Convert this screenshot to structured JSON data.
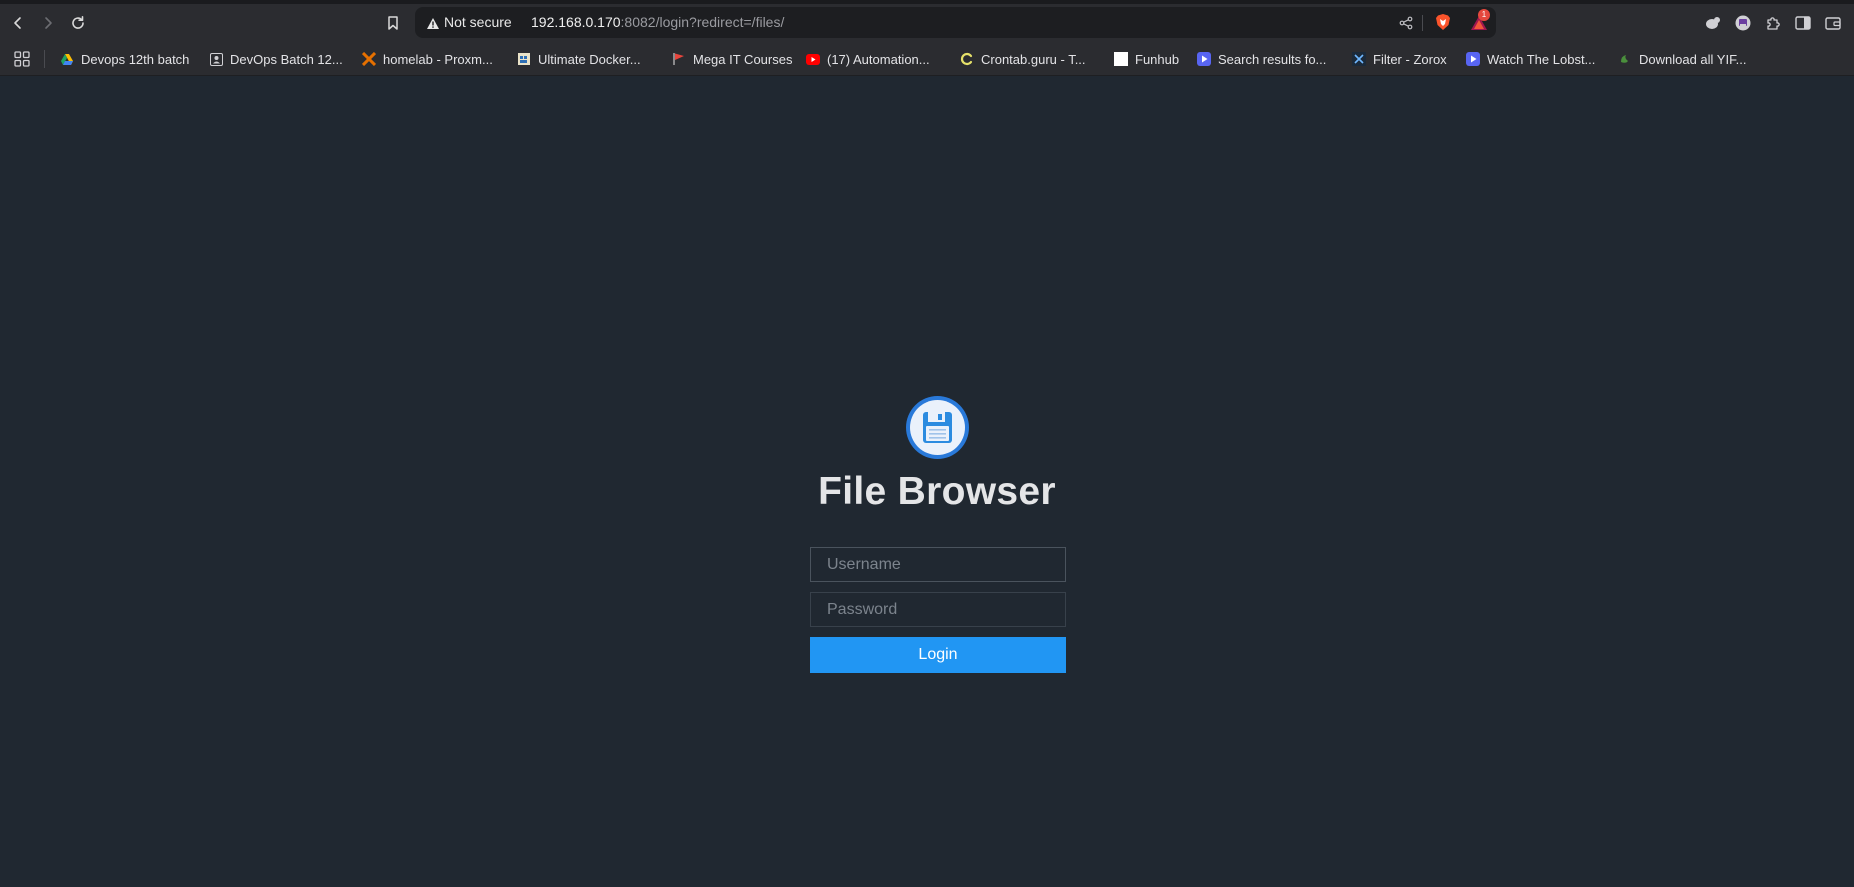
{
  "browser": {
    "security_label": "Not secure",
    "url_host": "192.168.0.170",
    "url_rest": ":8082/login?redirect=/files/",
    "rewards_badge": "1",
    "icons": {
      "back": "back-arrow-icon",
      "forward": "forward-arrow-icon",
      "reload": "reload-icon",
      "bookmark": "bookmark-icon",
      "warning": "warning-icon",
      "share": "share-icon",
      "brave": "brave-shield-icon",
      "rewards": "brave-rewards-icon",
      "extensions": "puzzle-icon",
      "sidebar": "sidebar-icon",
      "wallet": "wallet-icon"
    }
  },
  "bookmarks": [
    {
      "label": "Devops 12th batch",
      "icon": "google-drive-icon"
    },
    {
      "label": "DevOps Batch 12...",
      "icon": "contact-icon"
    },
    {
      "label": "homelab - Proxm...",
      "icon": "proxmox-icon"
    },
    {
      "label": "Ultimate Docker...",
      "icon": "docker-course-icon"
    },
    {
      "label": "Mega IT Courses",
      "icon": "flag-icon"
    },
    {
      "label": "(17) Automation...",
      "icon": "youtube-icon"
    },
    {
      "label": "Crontab.guru - T...",
      "icon": "crontab-icon"
    },
    {
      "label": "Funhub",
      "icon": "blank-page-icon"
    },
    {
      "label": "Search results fo...",
      "icon": "play-icon"
    },
    {
      "label": "Filter - Zorox",
      "icon": "zorox-icon"
    },
    {
      "label": "Watch The Lobst...",
      "icon": "play-icon"
    },
    {
      "label": "Download all YIF...",
      "icon": "yify-icon"
    }
  ],
  "login": {
    "title": "File Browser",
    "username_placeholder": "Username",
    "password_placeholder": "Password",
    "submit_label": "Login"
  },
  "colors": {
    "page_background": "#202831",
    "accent": "#2196f3",
    "toolbar": "#2b2c30"
  }
}
